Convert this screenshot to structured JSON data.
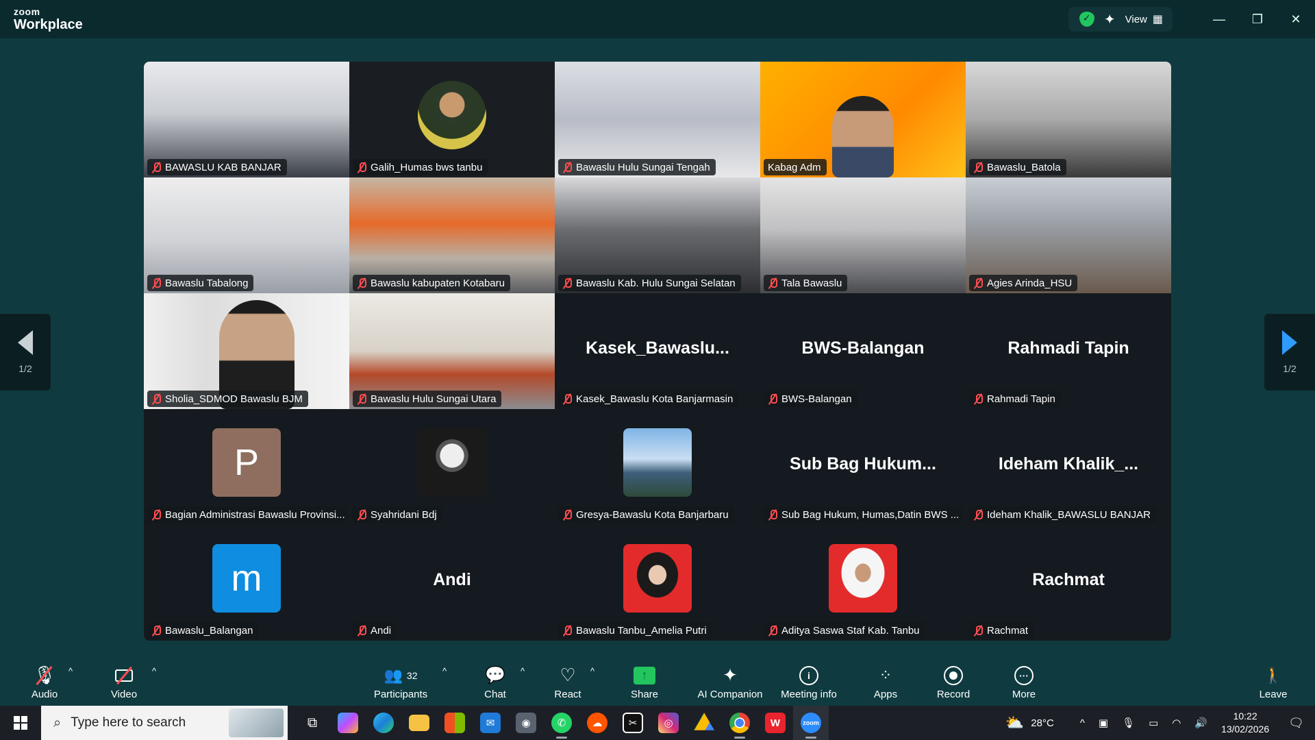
{
  "titlebar": {
    "brand_top": "zoom",
    "brand_bottom": "Workplace",
    "view_label": "View"
  },
  "nav": {
    "page_left": "1/2",
    "page_right": "1/2"
  },
  "tiles": [
    {
      "name": "BAWASLU KAB BANJAR"
    },
    {
      "name": "Galih_Humas bws tanbu"
    },
    {
      "name": "Bawaslu Hulu Sungai Tengah"
    },
    {
      "name": "Kabag Adm"
    },
    {
      "name": "Bawaslu_Batola"
    },
    {
      "name": "Bawaslu Tabalong"
    },
    {
      "name": "Bawaslu kabupaten Kotabaru"
    },
    {
      "name": "Bawaslu Kab. Hulu Sungai Selatan"
    },
    {
      "name": "Tala Bawaslu"
    },
    {
      "name": "Agies Arinda_HSU"
    },
    {
      "name": "Sholia_SDMOD Bawaslu BJM"
    },
    {
      "name": "Bawaslu Hulu Sungai Utara"
    },
    {
      "name": "Kasek_Bawaslu Kota Banjarmasin",
      "display": "Kasek_Bawaslu..."
    },
    {
      "name": "BWS-Balangan",
      "display": "BWS-Balangan"
    },
    {
      "name": "Rahmadi Tapin",
      "display": "Rahmadi Tapin"
    },
    {
      "name": "Bagian Administrasi Bawaslu Provinsi...",
      "avatar_letter": "P"
    },
    {
      "name": "Syahridani Bdj"
    },
    {
      "name": "Gresya-Bawaslu Kota Banjarbaru"
    },
    {
      "name": "Sub Bag Hukum, Humas,Datin  BWS ...",
      "display": "Sub Bag Hukum..."
    },
    {
      "name": "Ideham Khalik_BAWASLU BANJAR",
      "display": "Ideham  Khalik_..."
    },
    {
      "name": "Bawaslu_Balangan",
      "avatar_letter": "m"
    },
    {
      "name": "Andi",
      "display": "Andi"
    },
    {
      "name": "Bawaslu Tanbu_Amelia Putri"
    },
    {
      "name": "Aditya Saswa Staf Kab. Tanbu"
    },
    {
      "name": "Rachmat",
      "display": "Rachmat"
    }
  ],
  "toolbar": {
    "audio": "Audio",
    "video": "Video",
    "participants": "Participants",
    "participants_count": "32",
    "chat": "Chat",
    "react": "React",
    "share": "Share",
    "ai_companion": "AI Companion",
    "meeting_info": "Meeting info",
    "apps": "Apps",
    "record": "Record",
    "more": "More",
    "leave": "Leave"
  },
  "taskbar": {
    "search_placeholder": "Type here to search",
    "temperature": "28°C",
    "time": "10:22",
    "date": "13/02/2026"
  },
  "colors": {
    "background": "#0f3b40",
    "gallery": "#141a1f",
    "active_speaker": "#22d36b",
    "muted": "#ff4d4f",
    "share": "#22c55e"
  }
}
